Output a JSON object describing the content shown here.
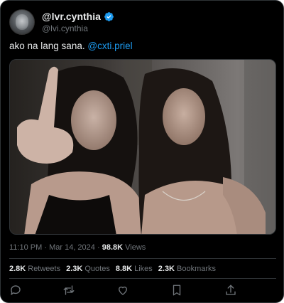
{
  "user": {
    "display_name": "@lvr.cynthia",
    "handle": "@lvi.cynthia",
    "verified": true,
    "verified_icon": "verified-badge-icon"
  },
  "tweet": {
    "text": "ako na lang sana.",
    "mention": "@cxti.priel"
  },
  "meta": {
    "time": "11:10 PM",
    "separator": "·",
    "date": "Mar 14, 2024",
    "views_count": "98.8K",
    "views_label": "Views"
  },
  "stats": {
    "retweets": {
      "count": "2.8K",
      "label": "Retweets"
    },
    "quotes": {
      "count": "2.3K",
      "label": "Quotes"
    },
    "likes": {
      "count": "8.8K",
      "label": "Likes"
    },
    "bookmarks": {
      "count": "2.3K",
      "label": "Bookmarks"
    }
  },
  "actions": [
    "reply-icon",
    "retweet-icon",
    "like-icon",
    "bookmark-icon",
    "share-icon"
  ],
  "colors": {
    "background": "#000000",
    "text": "#e7e9ea",
    "muted": "#71767b",
    "accent": "#1d9bf0",
    "border": "#2f3336"
  }
}
